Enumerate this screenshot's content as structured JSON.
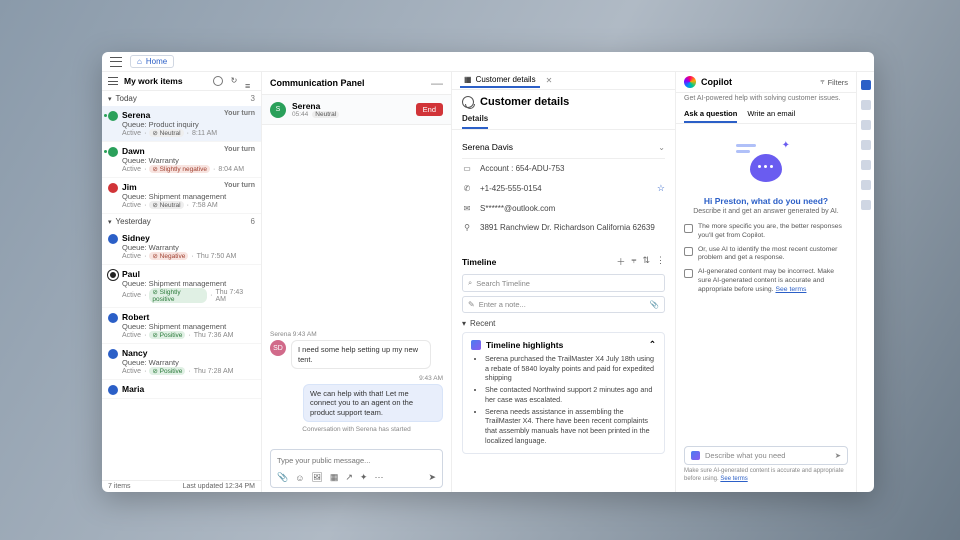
{
  "topbar": {
    "home": "Home"
  },
  "workItems": {
    "title": "My work items",
    "groups": [
      {
        "label": "Today",
        "count": "3"
      },
      {
        "label": "Yesterday",
        "count": "6"
      }
    ],
    "today": [
      {
        "name": "Serena",
        "turn": "Your turn",
        "queue": "Queue: Product inquiry",
        "status": "Active",
        "sentiment": "Neutral",
        "time": "8:11 AM",
        "dot": "green",
        "pres": true,
        "sel": true
      },
      {
        "name": "Dawn",
        "turn": "Your turn",
        "queue": "Queue: Warranty",
        "status": "Active",
        "sentiment": "Slightly negative",
        "time": "8:04 AM",
        "dot": "green",
        "pres": true
      },
      {
        "name": "Jim",
        "turn": "Your turn",
        "queue": "Queue: Shipment management",
        "status": "Active",
        "sentiment": "Neutral",
        "time": "7:58 AM",
        "dot": "red"
      }
    ],
    "yesterday": [
      {
        "name": "Sidney",
        "queue": "Queue: Warranty",
        "status": "Active",
        "sentiment": "Negative",
        "time": "Thu 7:50 AM",
        "dot": "blue"
      },
      {
        "name": "Paul",
        "queue": "Queue: Shipment management",
        "status": "Active",
        "sentiment": "Slightly positive",
        "time": "Thu 7:43 AM",
        "dot": "dark"
      },
      {
        "name": "Robert",
        "queue": "Queue: Shipment management",
        "status": "Active",
        "sentiment": "Positive",
        "time": "Thu 7:36 AM",
        "dot": "blue"
      },
      {
        "name": "Nancy",
        "queue": "Queue: Warranty",
        "status": "Active",
        "sentiment": "Positive",
        "time": "Thu 7:28 AM",
        "dot": "blue"
      },
      {
        "name": "Maria",
        "queue": "",
        "status": "",
        "sentiment": "",
        "time": "",
        "dot": "blue"
      }
    ],
    "footer": {
      "count": "7 items",
      "updated": "Last updated 12:34 PM"
    }
  },
  "comm": {
    "title": "Communication Panel",
    "contact": {
      "name": "Serena",
      "time": "05:44",
      "sentiment": "Neutral",
      "end": "End"
    },
    "msgs": {
      "m1meta": "Serena  9:43 AM",
      "m1": "I need some help setting up my new tent.",
      "m2meta": "9:43 AM",
      "m2": "We can help with that! Let me connect you to an agent on the product support team.",
      "sys": "Conversation with Serena has started"
    },
    "composer_ph": "Type your public message..."
  },
  "cust": {
    "tab": "Customer details",
    "title": "Customer details",
    "subtab": "Details",
    "name": "Serena Davis",
    "account": "Account : 654-ADU-753",
    "phone": "+1-425-555-0154",
    "email": "S******@outlook.com",
    "address": "3891 Ranchview Dr. Richardson California 62639",
    "timeline": {
      "title": "Timeline",
      "search_ph": "Search Timeline",
      "note_ph": "Enter a note...",
      "recent": "Recent",
      "highlights_title": "Timeline highlights",
      "h1": "Serena purchased the TrailMaster X4 July 18th using a rebate of 5840 loyalty points and paid for expedited shipping",
      "h2": "She contacted Northwind support 2 minutes ago and her case was escalated.",
      "h3": "Serena needs assistance in assembling the TrailMaster X4. There have been recent complaints that assembly manuals have not been printed in the localized language."
    }
  },
  "copilot": {
    "title": "Copilot",
    "filters": "Filters",
    "sub": "Get AI-powered help with solving customer issues.",
    "tab1": "Ask a question",
    "tab2": "Write an email",
    "greet": "Hi Preston, what do you need?",
    "desc": "Describe it and get an answer generated by AI.",
    "tip1": "The more specific you are, the better responses you'll get from Copilot.",
    "tip2": "Or, use AI to identify the most recent customer problem and get a response.",
    "tip3": "AI-generated content may be incorrect. Make sure AI-generated content is accurate and appropriate before using. ",
    "tip3link": "See terms",
    "input_ph": "Describe what you need",
    "disclaimer": "Make sure AI-generated content is accurate and appropriate before using. ",
    "disclink": "See terms"
  }
}
